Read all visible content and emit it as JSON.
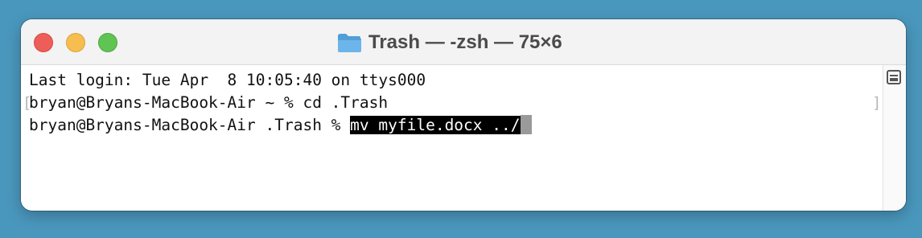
{
  "window": {
    "title": "Trash — -zsh — 75×6",
    "title_icon": "folder-icon"
  },
  "terminal": {
    "line1": "Last login: Tue Apr  8 10:05:40 on ttys000",
    "line2": "bryan@Bryans-MacBook-Air ~ % cd .Trash",
    "line3_prompt": "bryan@Bryans-MacBook-Air .Trash % ",
    "line3_selected_command": "mv myfile.docx ../",
    "bracket_left": "[",
    "bracket_right": "]"
  },
  "colors": {
    "desktop": "#4a97bd",
    "close": "#ee5e59",
    "minimize": "#f5be4f",
    "maximize": "#5fc453",
    "selection": "#000000",
    "cursor": "#9a9a9a"
  }
}
